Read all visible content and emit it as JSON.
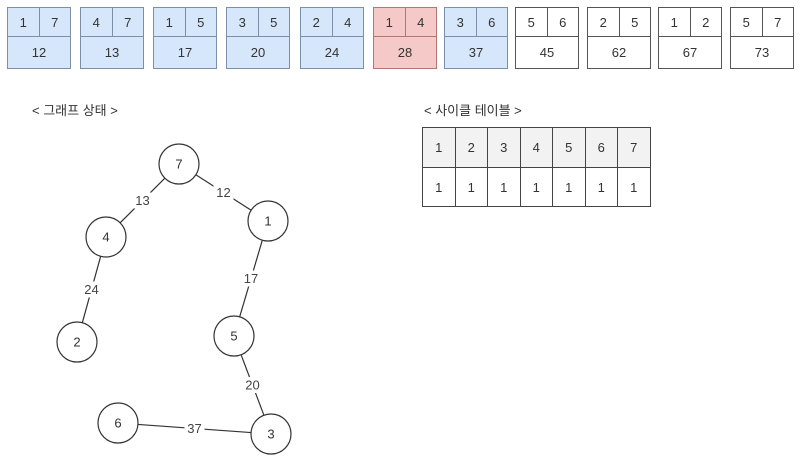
{
  "edges": [
    {
      "u": "1",
      "v": "7",
      "w": "12",
      "state": "used"
    },
    {
      "u": "4",
      "v": "7",
      "w": "13",
      "state": "used"
    },
    {
      "u": "1",
      "v": "5",
      "w": "17",
      "state": "used"
    },
    {
      "u": "3",
      "v": "5",
      "w": "20",
      "state": "used"
    },
    {
      "u": "2",
      "v": "4",
      "w": "24",
      "state": "used"
    },
    {
      "u": "1",
      "v": "4",
      "w": "28",
      "state": "cycle"
    },
    {
      "u": "3",
      "v": "6",
      "w": "37",
      "state": "used"
    },
    {
      "u": "5",
      "v": "6",
      "w": "45",
      "state": "pending"
    },
    {
      "u": "2",
      "v": "5",
      "w": "62",
      "state": "pending"
    },
    {
      "u": "1",
      "v": "2",
      "w": "67",
      "state": "pending"
    },
    {
      "u": "5",
      "v": "7",
      "w": "73",
      "state": "pending"
    }
  ],
  "graph_section": {
    "title": "< 그래프 상태 >"
  },
  "table_section": {
    "title": "< 사이클 테이블 >"
  },
  "cycle_table": {
    "headers": [
      "1",
      "2",
      "3",
      "4",
      "5",
      "6",
      "7"
    ],
    "values": [
      "1",
      "1",
      "1",
      "1",
      "1",
      "1",
      "1"
    ]
  },
  "graph": {
    "nodes": [
      "7",
      "4",
      "1",
      "2",
      "5",
      "6",
      "3"
    ],
    "links": [
      {
        "from": "7",
        "to": "4",
        "weight": "13"
      },
      {
        "from": "7",
        "to": "1",
        "weight": "12"
      },
      {
        "from": "4",
        "to": "2",
        "weight": "24"
      },
      {
        "from": "1",
        "to": "5",
        "weight": "17"
      },
      {
        "from": "5",
        "to": "3",
        "weight": "20"
      },
      {
        "from": "6",
        "to": "3",
        "weight": "37"
      }
    ]
  },
  "colors": {
    "used": "#d6e6fb",
    "cycle": "#f5c9c7",
    "pending": "#ffffff"
  }
}
